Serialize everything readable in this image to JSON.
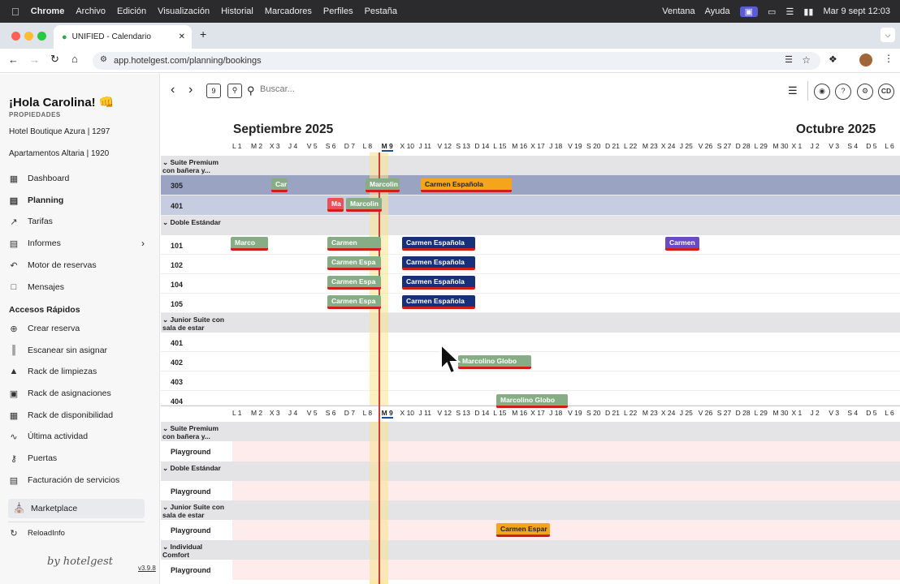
{
  "menubar": {
    "app": "Chrome",
    "items": [
      "Archivo",
      "Edición",
      "Visualización",
      "Historial",
      "Marcadores",
      "Perfiles",
      "Pestaña"
    ],
    "right_items": [
      "Ventana",
      "Ayuda"
    ],
    "datetime": "Mar 9 sept  12:03"
  },
  "browser": {
    "tab_title": "UNIFIED - Calendario",
    "url": "app.hotelgest.com/planning/bookings"
  },
  "sidebar": {
    "greeting": "¡Hola Carolina! 👊",
    "section_label": "PROPIEDADES",
    "properties": [
      "Hotel Boutique Azura | 1297",
      "Apartamentos Altaria | 1920"
    ],
    "nav": [
      {
        "label": "Dashboard",
        "icon": "grid-icon"
      },
      {
        "label": "Planning",
        "icon": "calendar-icon"
      },
      {
        "label": "Tarifas",
        "icon": "trend-icon"
      },
      {
        "label": "Informes",
        "icon": "report-icon"
      },
      {
        "label": "Motor de reservas",
        "icon": "engine-icon"
      },
      {
        "label": "Mensajes",
        "icon": "chat-icon"
      }
    ],
    "quick_title": "Accesos Rápidos",
    "quick": [
      {
        "label": "Crear reserva",
        "icon": "plus-circle-icon"
      },
      {
        "label": "Escanear sin asignar",
        "icon": "barcode-icon"
      },
      {
        "label": "Rack de limpiezas",
        "icon": "broom-icon"
      },
      {
        "label": "Rack de asignaciones",
        "icon": "assign-icon"
      },
      {
        "label": "Rack de disponibilidad",
        "icon": "availability-icon"
      },
      {
        "label": "Última actividad",
        "icon": "activity-icon"
      },
      {
        "label": "Puertas",
        "icon": "key-icon"
      },
      {
        "label": "Facturación de servicios",
        "icon": "invoice-icon"
      }
    ],
    "marketplace": "Marketplace",
    "reload": "ReloadInfo",
    "brand": "by hotelgest",
    "version": "v3.9.8"
  },
  "toolbar": {
    "search_placeholder": "Buscar...",
    "calendar_day": "9",
    "avatar": "CD"
  },
  "calendar": {
    "month_left": "Septiembre 2025",
    "month_right": "Octubre 2025",
    "days": [
      "L 1",
      "M 2",
      "X 3",
      "J 4",
      "V 5",
      "S 6",
      "D 7",
      "L 8",
      "M 9",
      "X 10",
      "J 11",
      "V 12",
      "S 13",
      "D 14",
      "L 15",
      "M 16",
      "X 17",
      "J 18",
      "V 19",
      "S 20",
      "D 21",
      "L 22",
      "M 23",
      "X 24",
      "J 25",
      "V 26",
      "S 27",
      "D 28",
      "L 29",
      "M 30",
      "X 1",
      "J 2",
      "V 3",
      "S 4",
      "D 5",
      "L 6"
    ],
    "today_index": 8,
    "groups_top": [
      {
        "category": "Suite Premium con bañera y...",
        "rooms": [
          "305",
          "401"
        ]
      },
      {
        "category": "Doble Estándar",
        "rooms": [
          "101",
          "102",
          "104",
          "105"
        ]
      },
      {
        "category": "Junior Suite con sala de estar",
        "rooms": [
          "401",
          "402",
          "403",
          "404"
        ]
      }
    ],
    "groups_bottom": [
      {
        "category": "Suite Premium con bañera y...",
        "rooms": [
          "Playground"
        ]
      },
      {
        "category": "Doble Estándar",
        "rooms": [
          "Playground"
        ]
      },
      {
        "category": "Junior Suite con sala de estar",
        "rooms": [
          "Playground"
        ]
      },
      {
        "category": "Individual Comfort",
        "rooms": [
          "Playground"
        ]
      }
    ],
    "bookings": [
      {
        "label": "Car",
        "color": "green"
      },
      {
        "label": "Marcolin",
        "color": "green"
      },
      {
        "label": "Carmen Española",
        "color": "orange"
      },
      {
        "label": "Ma",
        "color": "red"
      },
      {
        "label": "Marcolin",
        "color": "green"
      },
      {
        "label": "Marco",
        "color": "green"
      },
      {
        "label": "Carmen",
        "color": "green"
      },
      {
        "label": "Carmen Española",
        "color": "navy"
      },
      {
        "label": "Carmen",
        "color": "purple"
      },
      {
        "label": "Carmen Espa",
        "color": "green"
      },
      {
        "label": "Carmen Española",
        "color": "navy"
      },
      {
        "label": "Carmen Espa",
        "color": "green"
      },
      {
        "label": "Carmen Española",
        "color": "navy"
      },
      {
        "label": "Carmen Espa",
        "color": "green"
      },
      {
        "label": "Carmen Española",
        "color": "navy"
      },
      {
        "label": "Marcolino Globo",
        "color": "green"
      },
      {
        "label": "Marcolino Globo",
        "color": "green"
      },
      {
        "label": "Carmen Espar",
        "color": "orange"
      }
    ]
  }
}
